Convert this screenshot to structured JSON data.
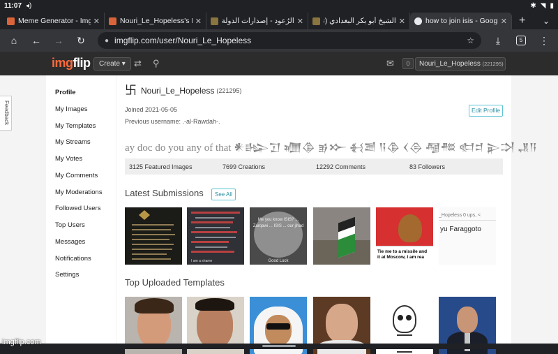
{
  "status_bar": {
    "time": "11:07"
  },
  "browser": {
    "tabs": [
      {
        "title": "Meme Generator - Imgflip",
        "fav_color": "#d9643a",
        "active": false
      },
      {
        "title": "Nouri_Le_Hopeless's Profile",
        "fav_color": "#d9643a",
        "active": false
      },
      {
        "title": "الرُعود - إصدارات الدولة الإسلامية",
        "fav_color": "#8a7440",
        "active": false
      },
      {
        "title": "الشيخ أبو بكر البغدادي (تقبله",
        "fav_color": "#8a7440",
        "active": false
      },
      {
        "title": "how to join isis - Google",
        "fav_color": "#e8eaed",
        "active": true
      }
    ],
    "url": "imgflip.com/user/Nouri_Le_Hopeless",
    "tab_count": "5"
  },
  "site_header": {
    "logo_a": "img",
    "logo_b": "flip",
    "create_label": "Create ▾",
    "notif_count": "0",
    "user_name": "Nouri_Le_Hopeless",
    "user_points": "(221295)"
  },
  "feedback_label": "Feedback",
  "sidebar": {
    "items": [
      "Profile",
      "My Images",
      "My Templates",
      "My Streams",
      "My Votes",
      "My Comments",
      "My Moderations",
      "Followed Users",
      "Top Users",
      "Messages",
      "Notifications",
      "Settings"
    ]
  },
  "profile": {
    "glyph": "卐",
    "username": "Nouri_Le_Hopeless",
    "points": "(221295)",
    "joined": "Joined 2021-05-05",
    "previous_username": "Previous username: .-al-Rawdah-.",
    "edit_label": "Edit Profile",
    "bio": "ay doc do you any of that 𒀭𒈗𒋛 𒁾𒆠 𒂊𒁍 𒈬𒍪 𒀀𒆠 𒌋𒁲 𒆷𒍣 𒊕𒄑 𒉌𒋫 𒂗𒀀",
    "stats": {
      "featured": "3125 Featured Images",
      "creations": "7699 Creations",
      "comments": "12292 Comments",
      "followers": "83 Followers"
    }
  },
  "latest": {
    "title": "Latest Submissions",
    "see_all": "See All",
    "t2_caption": "I am a shame",
    "t3_text": "Me you know ISIS? ... Zarqawi ... ISIS ... our jihad",
    "t3_caption": "Good Luck",
    "t5_caption_1": "Tie me to a missile and",
    "t5_caption_2": "it at Moscow, I am rea",
    "t6_top": "_Hopeless   0 ups, <",
    "t6_mid": "yu Faraggoto"
  },
  "templates_title": "Top Uploaded Templates",
  "watermark": "imgflip.com"
}
